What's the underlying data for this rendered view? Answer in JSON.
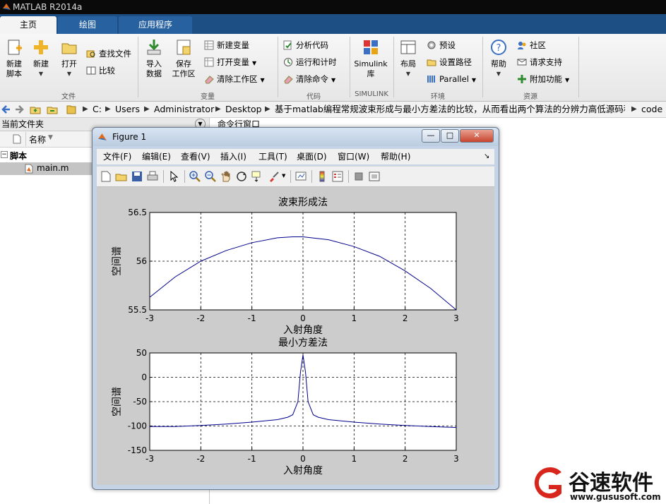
{
  "app": {
    "title": "MATLAB R2014a"
  },
  "ribbon": {
    "tabs": [
      "主页",
      "绘图",
      "应用程序"
    ],
    "groups": {
      "file": "文件",
      "variable": "变量",
      "code": "代码",
      "simulink": "SIMULINK",
      "environment": "环境",
      "resources": "资源"
    },
    "buttons": {
      "new_script": "新建\n脚本",
      "new": "新建",
      "open": "打开",
      "find_files": "查找文件",
      "compare": "比较",
      "import_data": "导入\n数据",
      "save_workspace": "保存\n工作区",
      "new_variable": "新建变量",
      "open_variable": "打开变量",
      "clear_workspace": "清除工作区",
      "analyze_code": "分析代码",
      "run_and_time": "运行和计时",
      "clear_commands": "清除命令",
      "simulink_library": "Simulink\n库",
      "layout": "布局",
      "preferences": "预设",
      "set_path": "设置路径",
      "parallel": "Parallel",
      "help": "帮助",
      "community": "社区",
      "request_support": "请求支持",
      "add_ons": "附加功能"
    }
  },
  "address": {
    "crumbs": [
      "C:",
      "Users",
      "Administrator",
      "Desktop",
      "基于matlab编程常规波束形成与最小方差法的比较，从而看出两个算法的分辨力高低源码程序",
      "code"
    ]
  },
  "current_folder": {
    "title": "当前文件夹",
    "column_name": "名称",
    "folder": "脚本",
    "file": "main.m"
  },
  "command_window": {
    "title": "命令行窗口"
  },
  "figure": {
    "title": "Figure 1",
    "menu": [
      "文件(F)",
      "编辑(E)",
      "查看(V)",
      "插入(I)",
      "工具(T)",
      "桌面(D)",
      "窗口(W)",
      "帮助(H)"
    ],
    "menu_more": "↘"
  },
  "chart_data": [
    {
      "type": "line",
      "title": "波束形成法",
      "xlabel": "入射角度",
      "ylabel": "空间谱",
      "xlim": [
        -3,
        3
      ],
      "ylim": [
        55.5,
        56.5
      ],
      "xticks": [
        -3,
        -2,
        -1,
        0,
        1,
        2,
        3
      ],
      "yticks": [
        55.5,
        56,
        56.5
      ],
      "grid": true,
      "color": "#00008b",
      "x": [
        -3,
        -2.5,
        -2,
        -1.5,
        -1,
        -0.5,
        -0.2,
        0,
        0.5,
        1,
        1.5,
        2,
        2.5,
        3
      ],
      "y": [
        55.63,
        55.84,
        56.0,
        56.11,
        56.19,
        56.24,
        56.25,
        56.25,
        56.22,
        56.15,
        56.05,
        55.9,
        55.72,
        55.5
      ]
    },
    {
      "type": "line",
      "title": "最小方差法",
      "xlabel": "入射角度",
      "ylabel": "空间谱",
      "xlim": [
        -3,
        3
      ],
      "ylim": [
        -150,
        50
      ],
      "xticks": [
        -3,
        -2,
        -1,
        0,
        1,
        2,
        3
      ],
      "yticks": [
        -150,
        -100,
        -50,
        0,
        50
      ],
      "grid": true,
      "color": "#00008b",
      "x": [
        -3,
        -2.5,
        -2,
        -1.5,
        -1,
        -0.5,
        -0.3,
        -0.2,
        -0.1,
        -0.05,
        0,
        0.05,
        0.1,
        0.2,
        0.3,
        0.5,
        1,
        1.5,
        2,
        2.5,
        3
      ],
      "y": [
        -101,
        -101,
        -99,
        -96,
        -92,
        -87,
        -82,
        -77,
        -50,
        10,
        46,
        10,
        -50,
        -77,
        -82,
        -87,
        -92,
        -96,
        -99,
        -101,
        -103
      ]
    }
  ],
  "watermark": {
    "brand": "谷速软件",
    "url": "www.gususoft.com"
  }
}
